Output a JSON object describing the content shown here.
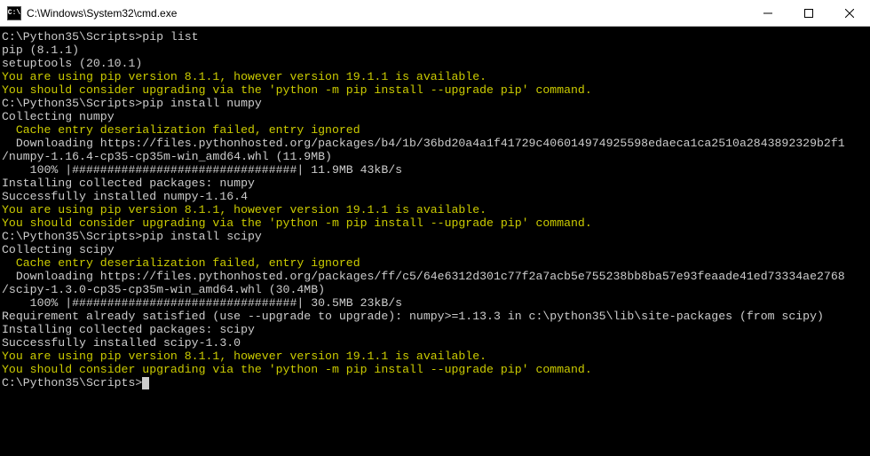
{
  "window": {
    "title": "C:\\Windows\\System32\\cmd.exe",
    "icon_label": "C:\\"
  },
  "lines": [
    {
      "color": "plain",
      "text": "C:\\Python35\\Scripts>pip list"
    },
    {
      "color": "plain",
      "text": "pip (8.1.1)"
    },
    {
      "color": "plain",
      "text": "setuptools (20.10.1)"
    },
    {
      "color": "warn",
      "text": "You are using pip version 8.1.1, however version 19.1.1 is available."
    },
    {
      "color": "warn",
      "text": "You should consider upgrading via the 'python -m pip install --upgrade pip' command."
    },
    {
      "color": "plain",
      "text": ""
    },
    {
      "color": "plain",
      "text": "C:\\Python35\\Scripts>pip install numpy"
    },
    {
      "color": "plain",
      "text": "Collecting numpy"
    },
    {
      "color": "warn",
      "text": "  Cache entry deserialization failed, entry ignored"
    },
    {
      "color": "plain",
      "text": "  Downloading https://files.pythonhosted.org/packages/b4/1b/36bd20a4a1f41729c406014974925598edaeca1ca2510a2843892329b2f1"
    },
    {
      "color": "plain",
      "text": "/numpy-1.16.4-cp35-cp35m-win_amd64.whl (11.9MB)"
    },
    {
      "color": "plain",
      "text": "    100% |################################| 11.9MB 43kB/s"
    },
    {
      "color": "plain",
      "text": "Installing collected packages: numpy"
    },
    {
      "color": "plain",
      "text": "Successfully installed numpy-1.16.4"
    },
    {
      "color": "warn",
      "text": "You are using pip version 8.1.1, however version 19.1.1 is available."
    },
    {
      "color": "warn",
      "text": "You should consider upgrading via the 'python -m pip install --upgrade pip' command."
    },
    {
      "color": "plain",
      "text": ""
    },
    {
      "color": "plain",
      "text": "C:\\Python35\\Scripts>pip install scipy"
    },
    {
      "color": "plain",
      "text": "Collecting scipy"
    },
    {
      "color": "warn",
      "text": "  Cache entry deserialization failed, entry ignored"
    },
    {
      "color": "plain",
      "text": "  Downloading https://files.pythonhosted.org/packages/ff/c5/64e6312d301c77f2a7acb5e755238bb8ba57e93feaade41ed73334ae2768"
    },
    {
      "color": "plain",
      "text": "/scipy-1.3.0-cp35-cp35m-win_amd64.whl (30.4MB)"
    },
    {
      "color": "plain",
      "text": "    100% |################################| 30.5MB 23kB/s"
    },
    {
      "color": "plain",
      "text": "Requirement already satisfied (use --upgrade to upgrade): numpy>=1.13.3 in c:\\python35\\lib\\site-packages (from scipy)"
    },
    {
      "color": "plain",
      "text": "Installing collected packages: scipy"
    },
    {
      "color": "plain",
      "text": "Successfully installed scipy-1.3.0"
    },
    {
      "color": "warn",
      "text": "You are using pip version 8.1.1, however version 19.1.1 is available."
    },
    {
      "color": "warn",
      "text": "You should consider upgrading via the 'python -m pip install --upgrade pip' command."
    },
    {
      "color": "plain",
      "text": ""
    },
    {
      "color": "plain",
      "text": "C:\\Python35\\Scripts>",
      "cursor": true
    }
  ]
}
